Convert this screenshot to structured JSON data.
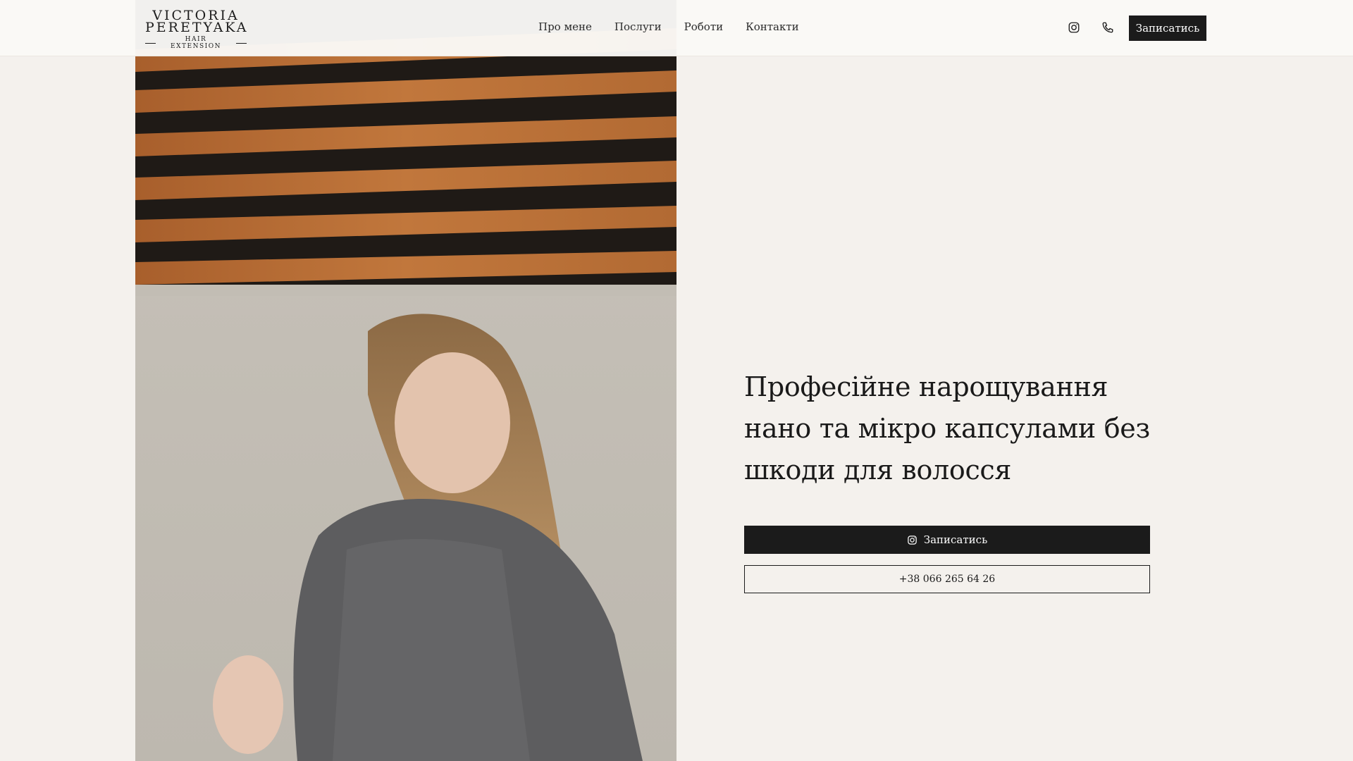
{
  "logo": {
    "line1": "VICTORIA",
    "line2": "PERETYAKA",
    "line3": "HAIR EXTENSION"
  },
  "nav": {
    "items": [
      {
        "label": "Про мене"
      },
      {
        "label": "Послуги"
      },
      {
        "label": "Роботи"
      },
      {
        "label": "Контакти"
      }
    ]
  },
  "header": {
    "icons": [
      "instagram-icon",
      "phone-icon"
    ],
    "book_label": "Записатись"
  },
  "hero": {
    "title": "Професійне нарощування нано та мікро капсулами без шкоди для волосся",
    "primary_cta": {
      "label": "Записатись",
      "icon": "instagram-icon"
    },
    "secondary_cta": {
      "label": "+38 066 265 64 26"
    },
    "photo_alt": "woman-with-long-blonde-hair-photo"
  },
  "colors": {
    "background": "#f4f1ed",
    "button_dark": "#1b1b1b",
    "text": "#1a1a1a"
  }
}
